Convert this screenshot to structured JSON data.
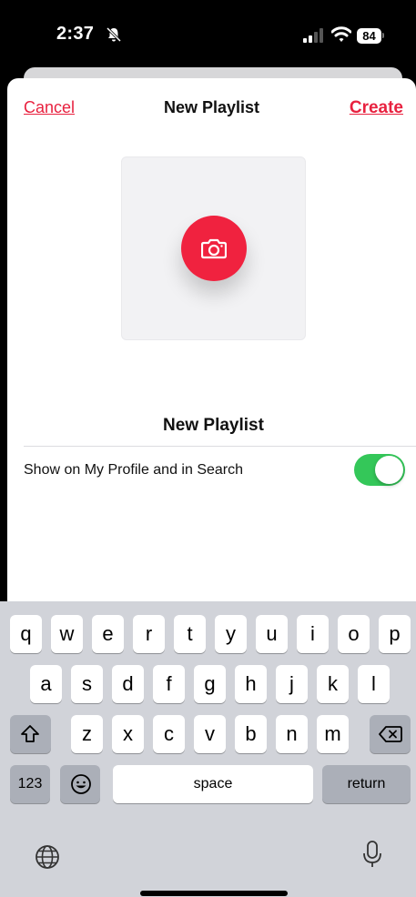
{
  "status": {
    "time": "2:37",
    "battery": "84"
  },
  "nav": {
    "cancel": "Cancel",
    "title": "New Playlist",
    "create": "Create"
  },
  "form": {
    "name_placeholder": "New Playlist",
    "toggle_label": "Show on My Profile and in Search",
    "toggle_on": true
  },
  "keyboard": {
    "row1": [
      "q",
      "w",
      "e",
      "r",
      "t",
      "y",
      "u",
      "i",
      "o",
      "p"
    ],
    "row2": [
      "a",
      "s",
      "d",
      "f",
      "g",
      "h",
      "j",
      "k",
      "l"
    ],
    "row3": [
      "z",
      "x",
      "c",
      "v",
      "b",
      "n",
      "m"
    ],
    "numbers": "123",
    "space": "space",
    "return": "return"
  },
  "colors": {
    "accent": "#e8213f",
    "toggle": "#34c759"
  },
  "icons": [
    "bell-slash-icon",
    "signal-icon",
    "wifi-icon",
    "camera-icon",
    "shift-icon",
    "delete-icon",
    "emoji-icon",
    "globe-icon",
    "microphone-icon"
  ]
}
